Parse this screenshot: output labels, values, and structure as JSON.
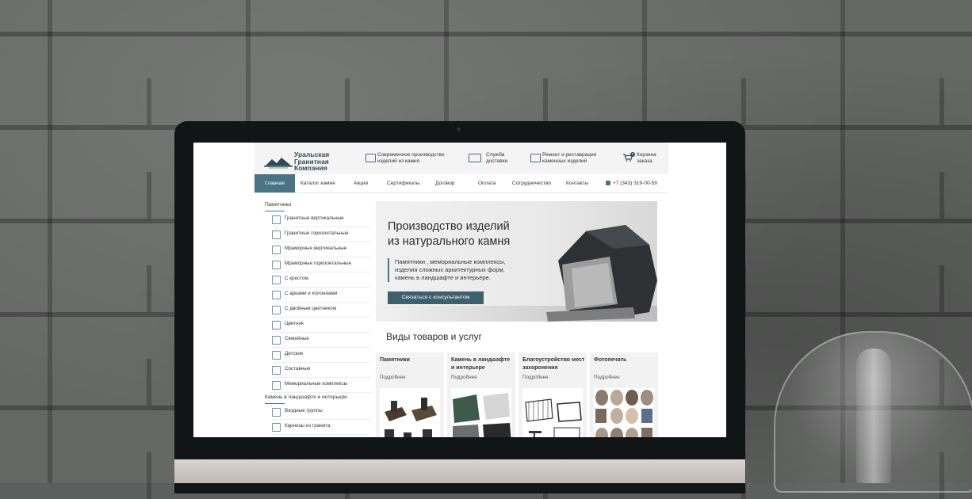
{
  "header": {
    "logo_lines": [
      "Уральская",
      "Гранитная",
      "Компания"
    ],
    "features": [
      {
        "icon": "monitor-icon",
        "lines": [
          "Современное производство",
          "изделий из камня"
        ]
      },
      {
        "icon": "truck-icon",
        "lines": [
          "Служба",
          "доставки"
        ]
      },
      {
        "icon": "repair-icon",
        "lines": [
          "Ремонт и реставрация",
          "каменных изделий"
        ]
      }
    ],
    "cart": {
      "icon": "cart-icon",
      "count": "0",
      "lines": [
        "Корзина",
        "заказа"
      ]
    }
  },
  "nav": {
    "items": [
      "Главная",
      "Каталог камня",
      "Акции",
      "Сертификаты",
      "Договор",
      "Оплата",
      "Сотрудничество",
      "Контакты"
    ],
    "active": "Главная",
    "phone": "+7 (343) 319-00-59"
  },
  "sidebar": {
    "section1": "Памятники",
    "items1": [
      "Гранитные вертикальные",
      "Гранитные горизонтальные",
      "Мраморные вертикальные",
      "Мраморные горизонтальные",
      "С крестом",
      "С арками и колоннами",
      "С двойным цветником",
      "Цветник",
      "Семейные",
      "Детские",
      "Составные",
      "Мемориальные комплексы"
    ],
    "section2": "Камень в ландшафте и интерьере",
    "items2": [
      "Входные группы",
      "Карнизы из гранита"
    ]
  },
  "hero": {
    "title_lines": [
      "Производство изделий",
      "из натурального камня"
    ],
    "text_lines": [
      "Памятники , мемориальные комплексы,",
      "изделия сложных архитектурных форм,",
      "камень в ландшафте и интерьере."
    ],
    "button": "Связаться с консультантом"
  },
  "products": {
    "title": "Виды товаров и услуг",
    "cards": [
      {
        "title": "Памятники",
        "more": "Подробнее"
      },
      {
        "title": "Камень в ландшафте и интерьере",
        "more": "Подробнее"
      },
      {
        "title": "Благоустройство мест захоронения",
        "more": "Подробнее"
      },
      {
        "title": "Фотопечать",
        "more": "Подробнее"
      }
    ]
  },
  "colors": {
    "accent": "#4a7483",
    "button": "#3e5f6c",
    "logo": "#2f4a57"
  }
}
